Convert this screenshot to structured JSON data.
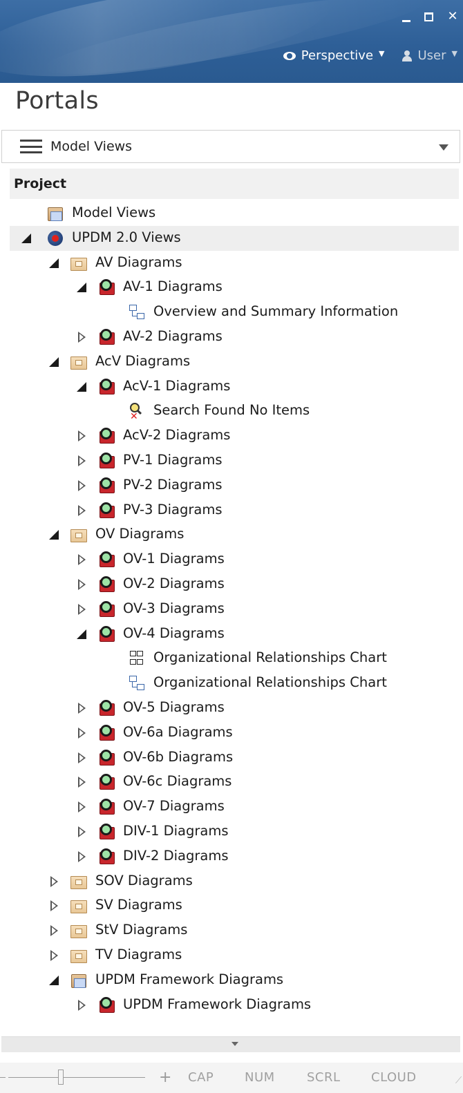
{
  "window": {
    "perspective_label": "Perspective",
    "user_label": "User"
  },
  "portals": {
    "title": "Portals",
    "selected_view": "Model Views"
  },
  "tree": {
    "header": "Project",
    "rows": [
      {
        "label": "Model Views",
        "depth": 0,
        "expander": "none",
        "icon": "stack-icon"
      },
      {
        "label": "UPDM 2.0 Views",
        "depth": 0,
        "expander": "expanded",
        "icon": "hexagon-icon",
        "selected": true
      },
      {
        "label": "AV Diagrams",
        "depth": 1,
        "expander": "expanded",
        "icon": "package-icon"
      },
      {
        "label": "AV-1 Diagrams",
        "depth": 2,
        "expander": "expanded",
        "icon": "search-icon"
      },
      {
        "label": "Overview and Summary Information",
        "depth": 3,
        "expander": "none",
        "icon": "diagram-icon"
      },
      {
        "label": "AV-2 Diagrams",
        "depth": 2,
        "expander": "collapsed",
        "icon": "search-icon"
      },
      {
        "label": "AcV Diagrams",
        "depth": 1,
        "expander": "expanded",
        "icon": "package-icon"
      },
      {
        "label": "AcV-1 Diagrams",
        "depth": 2,
        "expander": "expanded",
        "icon": "search-icon"
      },
      {
        "label": "Search Found No Items",
        "depth": 3,
        "expander": "none",
        "icon": "no-items-icon"
      },
      {
        "label": "AcV-2 Diagrams",
        "depth": 2,
        "expander": "collapsed",
        "icon": "search-icon"
      },
      {
        "label": "PV-1 Diagrams",
        "depth": 2,
        "expander": "collapsed",
        "icon": "search-icon"
      },
      {
        "label": "PV-2 Diagrams",
        "depth": 2,
        "expander": "collapsed",
        "icon": "search-icon"
      },
      {
        "label": "PV-3 Diagrams",
        "depth": 2,
        "expander": "collapsed",
        "icon": "search-icon"
      },
      {
        "label": "OV Diagrams",
        "depth": 1,
        "expander": "expanded",
        "icon": "package-icon"
      },
      {
        "label": "OV-1 Diagrams",
        "depth": 2,
        "expander": "collapsed",
        "icon": "search-icon"
      },
      {
        "label": "OV-2 Diagrams",
        "depth": 2,
        "expander": "collapsed",
        "icon": "search-icon"
      },
      {
        "label": "OV-3 Diagrams",
        "depth": 2,
        "expander": "collapsed",
        "icon": "search-icon"
      },
      {
        "label": "OV-4 Diagrams",
        "depth": 2,
        "expander": "expanded",
        "icon": "search-icon"
      },
      {
        "label": "Organizational Relationships Chart",
        "depth": 3,
        "expander": "none",
        "icon": "org-chart-icon"
      },
      {
        "label": "Organizational Relationships Chart",
        "depth": 3,
        "expander": "none",
        "icon": "diagram-icon"
      },
      {
        "label": "OV-5 Diagrams",
        "depth": 2,
        "expander": "collapsed",
        "icon": "search-icon"
      },
      {
        "label": "OV-6a Diagrams",
        "depth": 2,
        "expander": "collapsed",
        "icon": "search-icon"
      },
      {
        "label": "OV-6b Diagrams",
        "depth": 2,
        "expander": "collapsed",
        "icon": "search-icon"
      },
      {
        "label": "OV-6c Diagrams",
        "depth": 2,
        "expander": "collapsed",
        "icon": "search-icon"
      },
      {
        "label": "OV-7 Diagrams",
        "depth": 2,
        "expander": "collapsed",
        "icon": "search-icon"
      },
      {
        "label": "DIV-1 Diagrams",
        "depth": 2,
        "expander": "collapsed",
        "icon": "search-icon"
      },
      {
        "label": "DIV-2 Diagrams",
        "depth": 2,
        "expander": "collapsed",
        "icon": "search-icon"
      },
      {
        "label": "SOV Diagrams",
        "depth": 1,
        "expander": "collapsed",
        "icon": "package-icon"
      },
      {
        "label": "SV Diagrams",
        "depth": 1,
        "expander": "collapsed",
        "icon": "package-icon"
      },
      {
        "label": "StV Diagrams",
        "depth": 1,
        "expander": "collapsed",
        "icon": "package-icon"
      },
      {
        "label": "TV Diagrams",
        "depth": 1,
        "expander": "collapsed",
        "icon": "package-icon"
      },
      {
        "label": "UPDM Framework Diagrams",
        "depth": 1,
        "expander": "expanded",
        "icon": "stack-icon"
      },
      {
        "label": "UPDM Framework Diagrams",
        "depth": 2,
        "expander": "collapsed",
        "icon": "search-icon"
      }
    ]
  },
  "statusbar": {
    "zoom_plus": "+",
    "cap": "CAP",
    "num": "NUM",
    "scrl": "SCRL",
    "cloud": "CLOUD"
  },
  "colors": {
    "titlebar": "#2e5f97",
    "selected_row": "#eeeeee",
    "header_bg": "#f1f1f1"
  }
}
